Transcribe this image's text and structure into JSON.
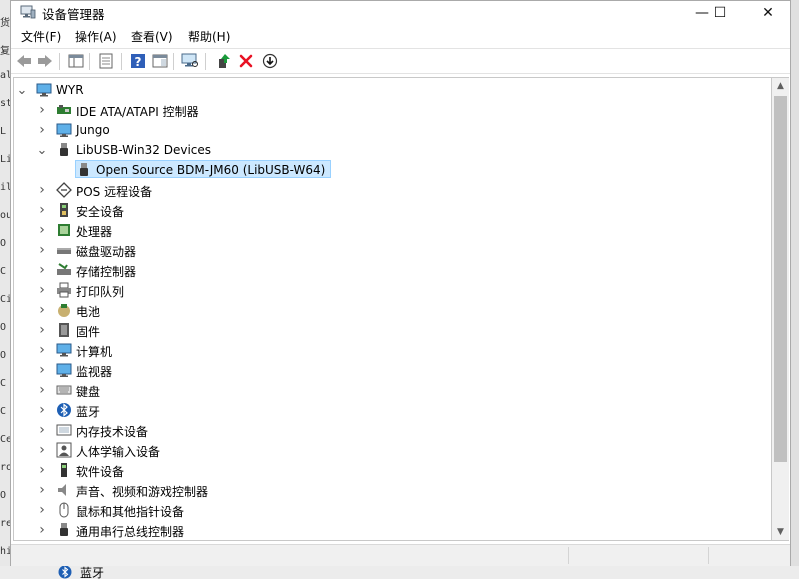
{
  "window": {
    "title": "设备管理器"
  },
  "controls": {
    "minimize": "—",
    "maximize": "☐",
    "close": "✕"
  },
  "menu": [
    "文件(F)",
    "操作(A)",
    "查看(V)",
    "帮助(H)"
  ],
  "tree": {
    "root": "WYR",
    "items": [
      {
        "label": "IDE ATA/ATAPI 控制器",
        "icon": "ide-controller-icon",
        "expanded": false
      },
      {
        "label": "Jungo",
        "icon": "monitor-icon",
        "expanded": false
      },
      {
        "label": "LibUSB-Win32 Devices",
        "icon": "usb-plug-icon",
        "expanded": true,
        "children": [
          {
            "label": "Open Source BDM-JM60 (LibUSB-W64)",
            "icon": "usb-plug-icon",
            "selected": true
          }
        ]
      },
      {
        "label": "POS 远程设备",
        "icon": "pos-device-icon",
        "expanded": false
      },
      {
        "label": "安全设备",
        "icon": "security-device-icon",
        "expanded": false
      },
      {
        "label": "处理器",
        "icon": "processor-icon",
        "expanded": false
      },
      {
        "label": "磁盘驱动器",
        "icon": "disk-drive-icon",
        "expanded": false
      },
      {
        "label": "存储控制器",
        "icon": "storage-controller-icon",
        "expanded": false
      },
      {
        "label": "打印队列",
        "icon": "printer-icon",
        "expanded": false
      },
      {
        "label": "电池",
        "icon": "battery-icon",
        "expanded": false
      },
      {
        "label": "固件",
        "icon": "firmware-icon",
        "expanded": false
      },
      {
        "label": "计算机",
        "icon": "computer-icon",
        "expanded": false
      },
      {
        "label": "监视器",
        "icon": "monitor-icon",
        "expanded": false
      },
      {
        "label": "键盘",
        "icon": "keyboard-icon",
        "expanded": false
      },
      {
        "label": "蓝牙",
        "icon": "bluetooth-icon",
        "expanded": false
      },
      {
        "label": "内存技术设备",
        "icon": "memory-device-icon",
        "expanded": false
      },
      {
        "label": "人体学输入设备",
        "icon": "hid-icon",
        "expanded": false
      },
      {
        "label": "软件设备",
        "icon": "software-device-icon",
        "expanded": false
      },
      {
        "label": "声音、视频和游戏控制器",
        "icon": "speaker-icon",
        "expanded": false
      },
      {
        "label": "鼠标和其他指针设备",
        "icon": "mouse-icon",
        "expanded": false
      },
      {
        "label": "通用串行总线控制器",
        "icon": "usb-plug-icon",
        "expanded": false
      }
    ]
  },
  "background": {
    "bottom_item": "蓝牙",
    "left_fragments": [
      "货",
      "复",
      "ale",
      "ste",
      "L",
      "Li",
      "il",
      "ou",
      "O",
      "C",
      "Ci",
      "O",
      "O",
      "C",
      "C",
      "Ce",
      "ro",
      "O",
      "re",
      "hi"
    ]
  },
  "colors": {
    "selection": "#cce8ff",
    "bluetooth": "#1e5fb4",
    "delete": "#e81123"
  }
}
